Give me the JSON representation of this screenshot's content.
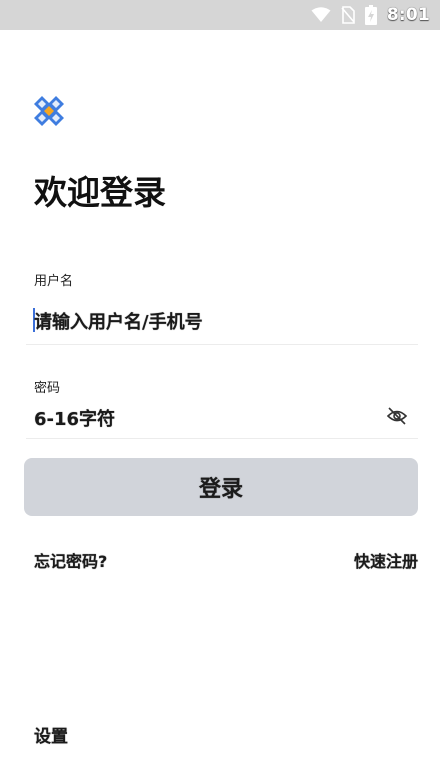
{
  "status_bar": {
    "time": "8:01",
    "icons": [
      "wifi-icon",
      "no-sim-icon",
      "battery-charging-icon"
    ]
  },
  "app": {
    "logo_icon": "app-logo-icon",
    "title": "欢迎登录"
  },
  "form": {
    "username": {
      "label": "用户名",
      "placeholder": "请输入用户名/手机号",
      "value": "请输入用户名/手机号"
    },
    "password": {
      "label": "密码",
      "placeholder": "6-16字符",
      "value": "6-16字符",
      "toggle_icon": "eye-off-icon"
    },
    "submit_label": "登录"
  },
  "links": {
    "forgot_password": "忘记密码?",
    "quick_register": "快速注册"
  },
  "footer": {
    "settings": "设置"
  },
  "colors": {
    "status_bar_bg": "#d6d6d6",
    "button_bg": "#d1d4da",
    "logo_blue": "#3f7de0",
    "logo_orange": "#f5a623",
    "cursor": "#3b6fd8"
  }
}
